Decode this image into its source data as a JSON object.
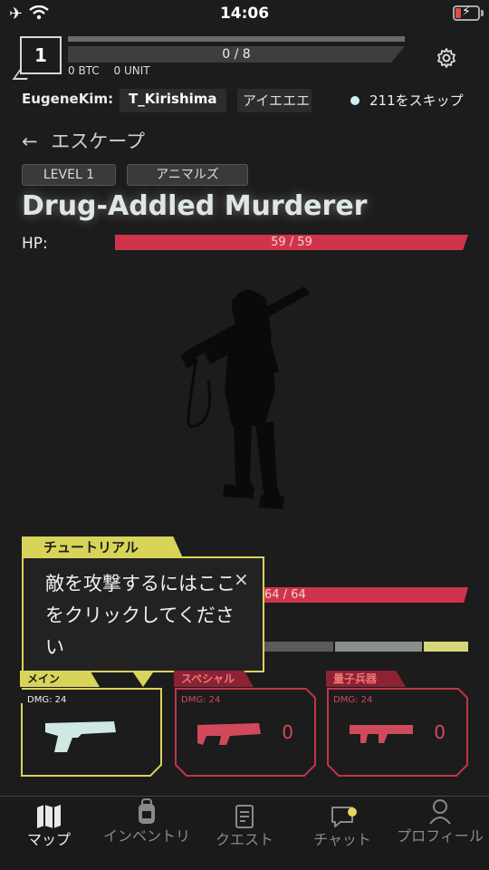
{
  "status": {
    "time": "14:06"
  },
  "header": {
    "level": "1",
    "xp": "0 / 8",
    "btc": "0 BTC",
    "unit": "0 UNIT"
  },
  "players": {
    "p1": "EugeneKim:",
    "p2": "T_Kirishima",
    "p3": "アイエエエ",
    "skip": "211をスキップ"
  },
  "nav_back": {
    "label": "エスケープ"
  },
  "enemy": {
    "tags": [
      "LEVEL 1",
      "アニマルズ"
    ],
    "name": "Drug-Addled Murderer",
    "hp_label": "HP:",
    "hp_text": "59 / 59",
    "hp_fraction": 1.0
  },
  "player": {
    "hp_text": "64 / 64"
  },
  "tutorial": {
    "title": "チュートリアル",
    "message": "敵を攻撃するにはここをクリックしてください",
    "close": "×"
  },
  "weapons": [
    {
      "tab": "メイン",
      "dmg": "DMG: 24",
      "count": "",
      "color": "#cfe8e4"
    },
    {
      "tab": "スペシャル",
      "dmg": "DMG: 24",
      "count": "0",
      "color": "#d04a5c"
    },
    {
      "tab": "量子兵器",
      "dmg": "DMG: 24",
      "count": "0",
      "color": "#d04a5c"
    }
  ],
  "bottom_nav": [
    {
      "label": "マップ",
      "icon": "map-icon",
      "active": true
    },
    {
      "label": "インベントリ",
      "icon": "backpack-icon",
      "active": false
    },
    {
      "label": "クエスト",
      "icon": "document-icon",
      "active": false
    },
    {
      "label": "チャット",
      "icon": "chat-icon",
      "active": false
    },
    {
      "label": "プロフィール",
      "icon": "profile-icon",
      "active": false
    }
  ],
  "colors": {
    "accent_yellow": "#d8d45a",
    "hp_red": "#d0344a",
    "background": "#1c1c1c"
  }
}
